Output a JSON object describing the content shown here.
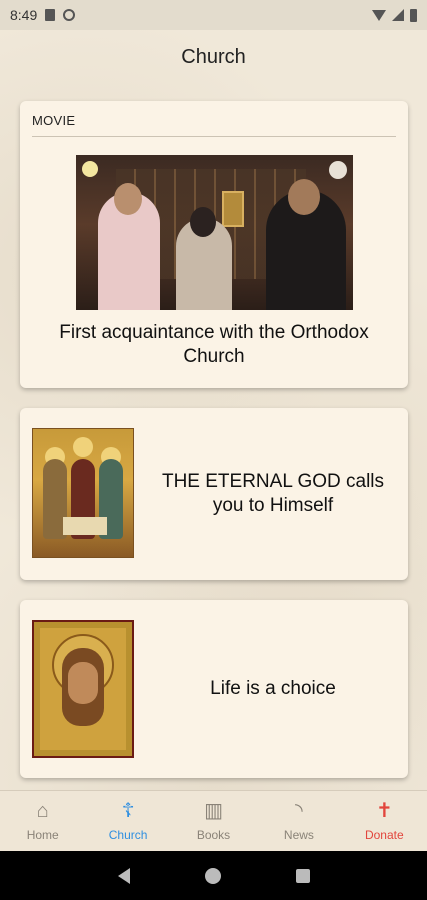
{
  "status_bar": {
    "time": "8:49"
  },
  "header": {
    "title": "Church"
  },
  "cards": [
    {
      "label": "MOVIE",
      "title": "First acquaintance with the Orthodox Church"
    },
    {
      "title": "THE ETERNAL GOD calls you to Himself"
    },
    {
      "title": "Life is a choice"
    }
  ],
  "bottom_nav": {
    "items": [
      {
        "label": "Home",
        "icon": "home-icon"
      },
      {
        "label": "Church",
        "icon": "orthodox-cross-icon"
      },
      {
        "label": "Books",
        "icon": "books-icon"
      },
      {
        "label": "News",
        "icon": "rss-icon"
      },
      {
        "label": "Donate",
        "icon": "person-heart-icon"
      }
    ],
    "active": "Church",
    "active_color": "#2f8fe0",
    "donate_color": "#e2453c"
  }
}
